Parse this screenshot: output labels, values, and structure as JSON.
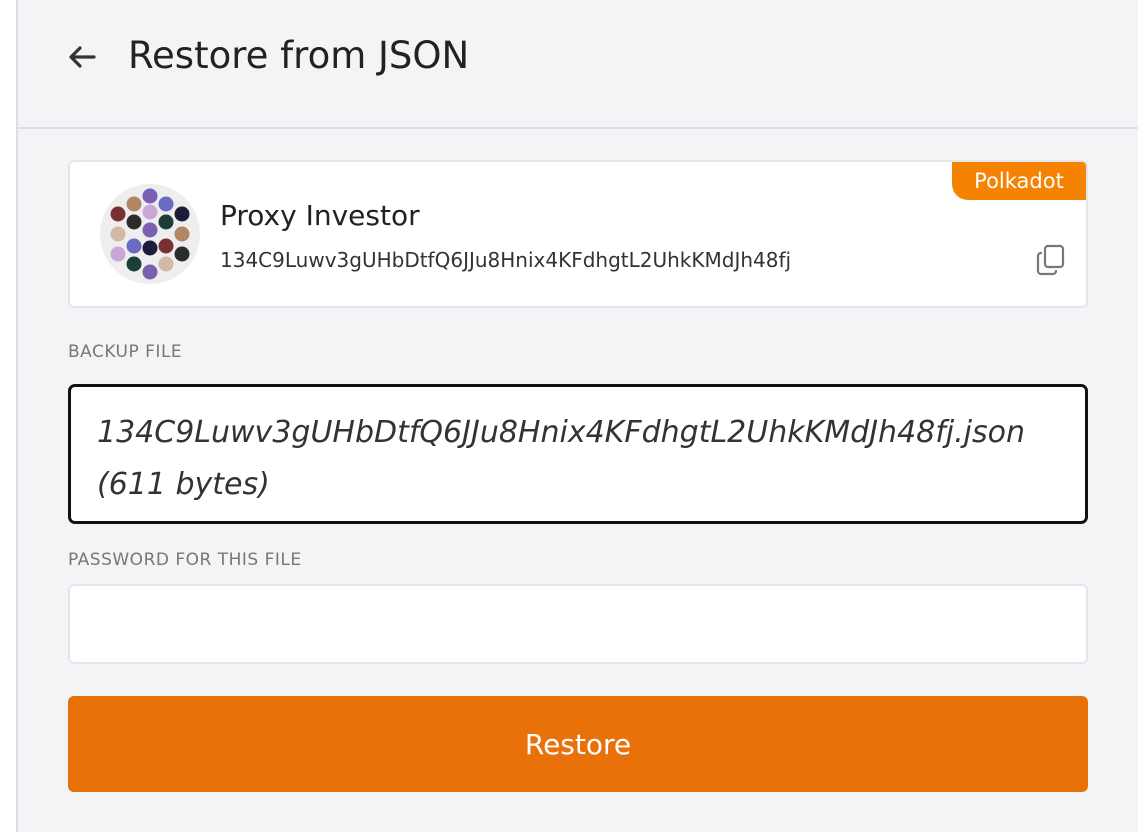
{
  "header": {
    "title": "Restore from JSON",
    "back_icon": "arrow-left-icon"
  },
  "account": {
    "name": "Proxy Investor",
    "address": "134C9Luwv3gUHbDtfQ6JJu8Hnix4KFdhgtL2UhkKMdJh48fj",
    "network": "Polkadot",
    "avatar_icon": "identicon",
    "copy_icon": "copy-icon",
    "avatar_colors": [
      "#7a5fb5",
      "#b28563",
      "#6b6bc4",
      "#7a3030",
      "#caa8d6",
      "#1c1c3c",
      "#2b2b2b",
      "#1d3e34",
      "#d4b8a6"
    ]
  },
  "backup": {
    "label": "BACKUP FILE",
    "file_display": "134C9Luwv3gUHbDtfQ6JJu8Hnix4KFdhgtL2UhkKMdJh48fj.json (611 bytes)"
  },
  "password": {
    "label": "PASSWORD FOR THIS FILE",
    "value": "",
    "placeholder": ""
  },
  "actions": {
    "restore_label": "Restore"
  },
  "colors": {
    "accent": "#e8710a",
    "badge": "#f58200"
  }
}
